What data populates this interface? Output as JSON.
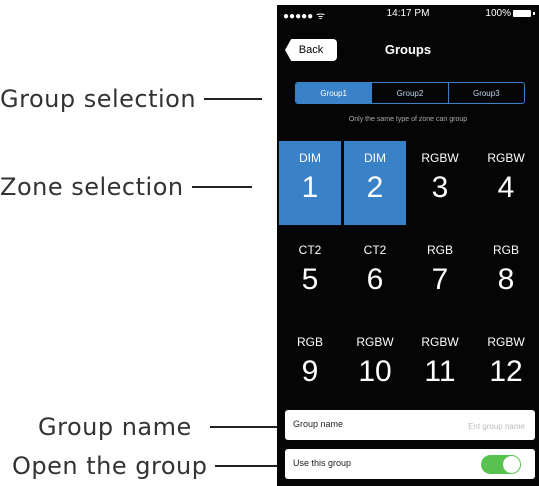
{
  "callouts": {
    "group_selection": "Group selection",
    "zone_selection": "Zone selection",
    "group_name": "Group name",
    "open_group": "Open the group"
  },
  "status": {
    "time": "14:17 PM",
    "battery": "100%",
    "signal": "●●●●● ᯤ"
  },
  "nav": {
    "back": "Back",
    "title": "Groups"
  },
  "groups": {
    "tabs": [
      "Group1",
      "Group2",
      "Group3"
    ],
    "selected": "Group1",
    "hint": "Only the same type of zone can group"
  },
  "zones": [
    {
      "type": "DIM",
      "num": "1",
      "selected": true
    },
    {
      "type": "DIM",
      "num": "2",
      "selected": true
    },
    {
      "type": "RGBW",
      "num": "3",
      "selected": false
    },
    {
      "type": "RGBW",
      "num": "4",
      "selected": false
    },
    {
      "type": "CT2",
      "num": "5",
      "selected": false
    },
    {
      "type": "CT2",
      "num": "6",
      "selected": false
    },
    {
      "type": "RGB",
      "num": "7",
      "selected": false
    },
    {
      "type": "RGB",
      "num": "8",
      "selected": false
    },
    {
      "type": "RGB",
      "num": "9",
      "selected": false
    },
    {
      "type": "RGBW",
      "num": "10",
      "selected": false
    },
    {
      "type": "RGBW",
      "num": "11",
      "selected": false
    },
    {
      "type": "RGBW",
      "num": "12",
      "selected": false
    }
  ],
  "group_name": {
    "label": "Group name",
    "value": "",
    "placeholder": "Ent group name"
  },
  "use_group": {
    "label": "Use this group",
    "enabled": true
  },
  "colors": {
    "accent": "#3a82c8",
    "toggle_on": "#58c24e",
    "background": "#050505"
  }
}
